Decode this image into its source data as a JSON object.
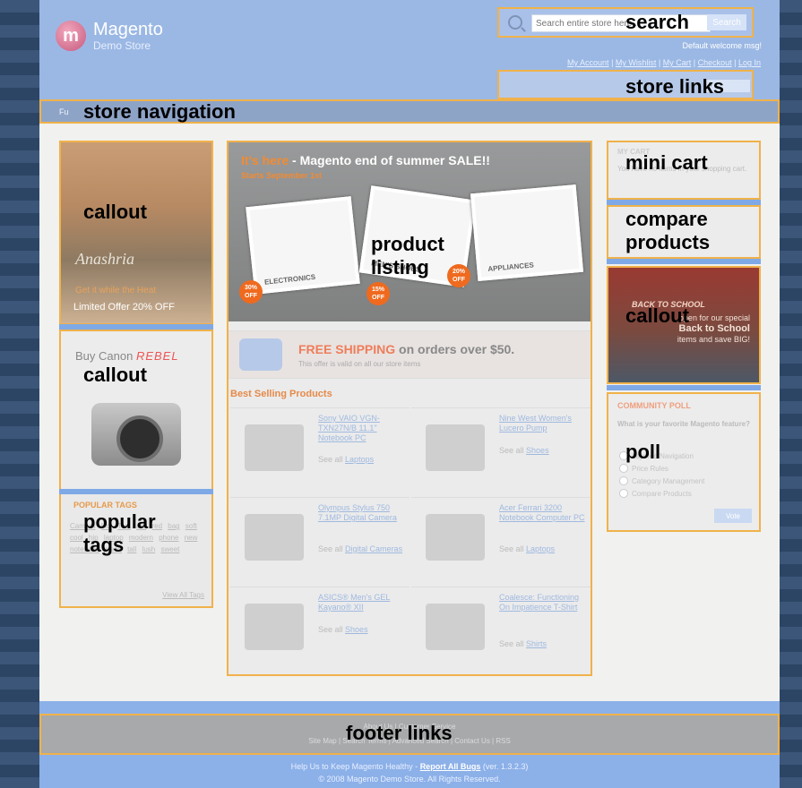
{
  "logo": {
    "name": "Magento",
    "sub": "Demo Store",
    "mark": "m"
  },
  "search": {
    "placeholder": "Search entire store here...",
    "button": "Search"
  },
  "header": {
    "welcome": "Default welcome msg!",
    "links": [
      "My Account",
      "My Wishlist",
      "My Cart",
      "Checkout",
      "Log In"
    ]
  },
  "nav": {
    "first_item": "Fu"
  },
  "labels": {
    "search": "search",
    "store_links": "store links",
    "store_navigation": "store navigation",
    "callout_left_top": "callout",
    "callout_left_mid": "callout",
    "popular_tags": "popular\ntags",
    "product_listing": "product\nlisting",
    "mini_cart": "mini cart",
    "compare_products": "compare\nproducts",
    "callout_right": "callout",
    "poll": "poll",
    "footer_links": "footer links"
  },
  "callouts": {
    "left_top": {
      "brand": "Anashria",
      "sub": "Get it while the Heat",
      "offer": "Limited Offer 20% OFF"
    },
    "left_mid": {
      "text": "Buy Canon",
      "brand": "REBEL"
    },
    "right": {
      "top": "BACK TO SCHOOL",
      "line1": "open",
      "line2": "for our special",
      "line3": "Back to School",
      "line4": "items",
      "line5": "and save BIG!"
    }
  },
  "tags": {
    "title": "POPULAR TAGS",
    "cloud": [
      "Camera",
      "Hot",
      "Test",
      "ant",
      "red",
      "bag",
      "soft",
      "cool",
      "hip",
      "laptop",
      "modern",
      "phone",
      "new",
      "notebook",
      "sleek",
      "tall",
      "lush",
      "sweet"
    ],
    "view_all": "View All Tags"
  },
  "banner": {
    "title_hl": "It's here",
    "title_rest": " - Magento end of summer SALE!!",
    "sub": "Starts September 1st",
    "cards": [
      "ELECTRONICS",
      "MEN'S SHOES",
      "APPLIANCES"
    ],
    "badges": [
      "30% OFF",
      "15% OFF",
      "20% OFF"
    ]
  },
  "shipping": {
    "hl": "FREE SHIPPING",
    "rest": " on orders over $50.",
    "sub": "This offer is valid on all our store items"
  },
  "best_selling": {
    "title": "Best Selling Products",
    "products": [
      {
        "name": "Sony VAIO VGN-TXN27N/B 11.1\" Notebook PC",
        "see": "See all",
        "cat": "Laptops"
      },
      {
        "name": "Nine West Women's Lucero Pump",
        "see": "See all",
        "cat": "Shoes"
      },
      {
        "name": "Olympus Stylus 750 7.1MP Digital Camera",
        "see": "See all",
        "cat": "Digital Cameras"
      },
      {
        "name": "Acer Ferrari 3200 Notebook Computer PC",
        "see": "See all",
        "cat": "Laptops"
      },
      {
        "name": "ASICS® Men's GEL Kayano® XII",
        "see": "See all",
        "cat": "Shoes"
      },
      {
        "name": "Coalesce: Functioning On Impatience T-Shirt",
        "see": "See all",
        "cat": "Shirts"
      }
    ]
  },
  "minicart": {
    "title": "MY CART",
    "text": "You have no items in your shopping cart."
  },
  "poll": {
    "title": "COMMUNITY POLL",
    "question": "What is your favorite Magento feature?",
    "options": [
      "Layered Navigation",
      "Price Rules",
      "Category Management",
      "Compare Products"
    ],
    "button": "Vote"
  },
  "footer": {
    "row1": "About Us | Customer Service",
    "row2": "Site Map | Search Terms | Advanced Search | Contact Us | RSS",
    "help": "Help Us to Keep Magento Healthy - ",
    "bug": "Report All Bugs",
    "ver": " (ver. 1.3.2.3)",
    "copy": "© 2008 Magento Demo Store. All Rights Reserved."
  },
  "colors": {
    "accent_border": "#f0b24a",
    "header_blue": "#9bb8e4",
    "footer_blue": "#8cb0e8"
  }
}
